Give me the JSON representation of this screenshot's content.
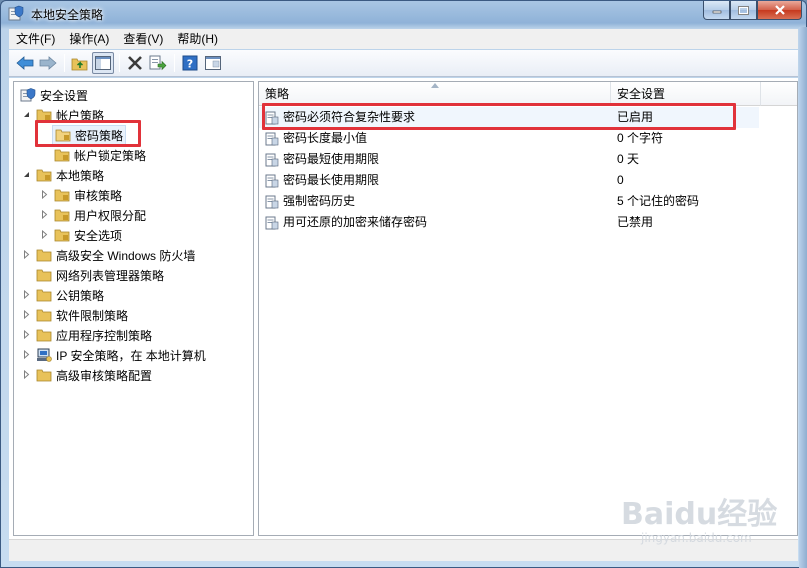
{
  "window": {
    "title": "本地安全策略",
    "icon": "security-policy-icon"
  },
  "menu": {
    "items": [
      "文件(F)",
      "操作(A)",
      "查看(V)",
      "帮助(H)"
    ]
  },
  "toolbar": {
    "buttons": [
      "back-arrow-icon",
      "forward-arrow-icon",
      "up-folder-icon",
      "show-hide-tree-icon",
      "delete-icon",
      "export-list-icon",
      "help-icon",
      "properties-icon"
    ]
  },
  "tree": {
    "root": "安全设置",
    "account_policies": "帐户策略",
    "password_policy": "密码策略",
    "lockout_policy": "帐户锁定策略",
    "local_policies": "本地策略",
    "audit_policy": "审核策略",
    "user_rights": "用户权限分配",
    "security_options": "安全选项",
    "firewall": "高级安全 Windows 防火墙",
    "network_list": "网络列表管理器策略",
    "public_key": "公钥策略",
    "software_restriction": "软件限制策略",
    "app_control": "应用程序控制策略",
    "ipsec": "IP 安全策略，在 本地计算机",
    "advanced_audit": "高级审核策略配置"
  },
  "list": {
    "col_policy": "策略",
    "col_setting": "安全设置",
    "rows": [
      {
        "policy": "密码必须符合复杂性要求",
        "setting": "已启用"
      },
      {
        "policy": "密码长度最小值",
        "setting": "0 个字符"
      },
      {
        "policy": "密码最短使用期限",
        "setting": "0 天"
      },
      {
        "policy": "密码最长使用期限",
        "setting": "0"
      },
      {
        "policy": "强制密码历史",
        "setting": "5 个记住的密码"
      },
      {
        "policy": "用可还原的加密来储存密码",
        "setting": "已禁用"
      }
    ]
  },
  "watermark": {
    "logo": "Baidu经验",
    "url": "jingyan.baidu.com"
  },
  "colors": {
    "highlight_box": "#e1323a",
    "folder": "#e8c25a",
    "selection": "#e8f1fb"
  }
}
